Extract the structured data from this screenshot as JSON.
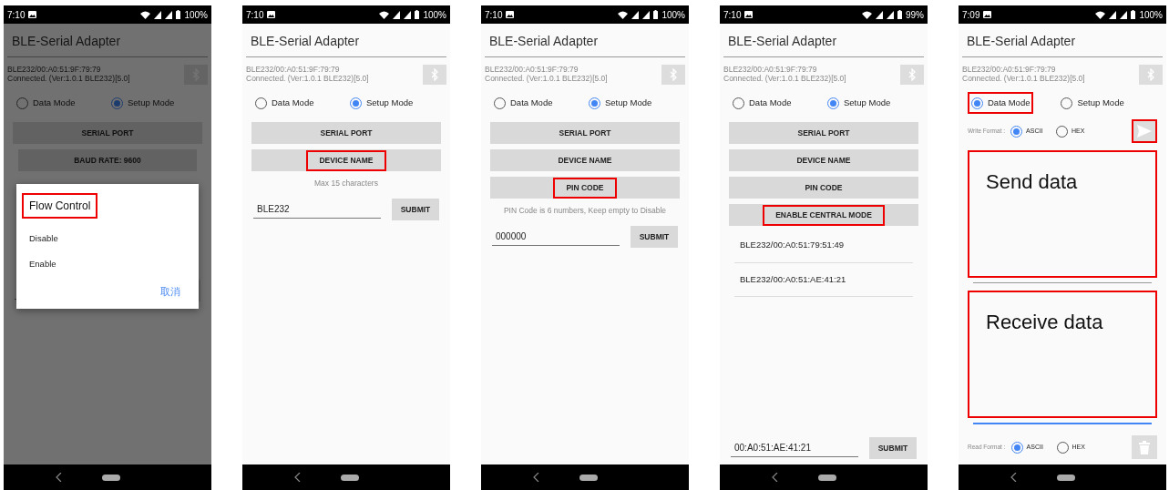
{
  "phones": [
    {
      "status": {
        "time": "7:10",
        "battery": "100%"
      },
      "title": "BLE-Serial Adapter",
      "device": [
        "BLE232/00:A0:51:9F:79:79",
        "Connected. (Ver:1.0.1 BLE232)[5.0]"
      ],
      "dimmed": true,
      "modes": [
        {
          "label": "Data Mode",
          "selected": false,
          "highlighted": false
        },
        {
          "label": "Setup Mode",
          "selected": true,
          "highlighted": false
        }
      ],
      "items": [
        {
          "kind": "button",
          "label": "SERIAL PORT",
          "highlighted": false
        },
        {
          "kind": "sub_button",
          "label": "BAUD RATE: 9600",
          "highlighted": false
        },
        {
          "kind": "covered"
        },
        {
          "kind": "field"
        }
      ],
      "dialog": {
        "title": "Flow Control",
        "highlighted": true,
        "options": [
          "Disable",
          "Enable"
        ],
        "cancel": "取消"
      }
    },
    {
      "status": {
        "time": "7:10",
        "battery": "100%"
      },
      "title": "BLE-Serial Adapter",
      "device": [
        "BLE232/00:A0:51:9F:79:79",
        "Connected. (Ver:1.0.1 BLE232)[5.0]"
      ],
      "dimmed": false,
      "modes": [
        {
          "label": "Data Mode",
          "selected": false,
          "highlighted": false
        },
        {
          "label": "Setup Mode",
          "selected": true,
          "highlighted": false
        }
      ],
      "items": [
        {
          "kind": "button",
          "label": "SERIAL PORT",
          "highlighted": false
        },
        {
          "kind": "button",
          "label": "DEVICE NAME",
          "highlighted": true
        },
        {
          "kind": "hint",
          "text": "Max 15 characters"
        },
        {
          "kind": "field",
          "value": "BLE232",
          "submit": "SUBMIT"
        }
      ]
    },
    {
      "status": {
        "time": "7:10",
        "battery": "100%"
      },
      "title": "BLE-Serial Adapter",
      "device": [
        "BLE232/00:A0:51:9F:79:79",
        "Connected. (Ver:1.0.1 BLE232)[5.0]"
      ],
      "dimmed": false,
      "modes": [
        {
          "label": "Data Mode",
          "selected": false,
          "highlighted": false
        },
        {
          "label": "Setup Mode",
          "selected": true,
          "highlighted": false
        }
      ],
      "items": [
        {
          "kind": "button",
          "label": "SERIAL PORT",
          "highlighted": false
        },
        {
          "kind": "button",
          "label": "DEVICE NAME",
          "highlighted": false
        },
        {
          "kind": "button",
          "label": "PIN CODE",
          "highlighted": true
        },
        {
          "kind": "hint",
          "text": "PIN Code is 6 numbers, Keep empty to Disable"
        },
        {
          "kind": "field",
          "value": "000000",
          "submit": "SUBMIT"
        }
      ]
    },
    {
      "status": {
        "time": "7:10",
        "battery": "99%"
      },
      "title": "BLE-Serial Adapter",
      "device": [
        "BLE232/00:A0:51:9F:79:79",
        "Connected. (Ver:1.0.1 BLE232)[5.0]"
      ],
      "dimmed": false,
      "modes": [
        {
          "label": "Data Mode",
          "selected": false,
          "highlighted": false
        },
        {
          "label": "Setup Mode",
          "selected": true,
          "highlighted": false
        }
      ],
      "items": [
        {
          "kind": "button",
          "label": "SERIAL PORT",
          "highlighted": false
        },
        {
          "kind": "button",
          "label": "DEVICE NAME",
          "highlighted": false
        },
        {
          "kind": "button",
          "label": "PIN CODE",
          "highlighted": false
        },
        {
          "kind": "button",
          "label": "ENABLE CENTRAL MODE",
          "highlighted": true
        },
        {
          "kind": "device",
          "text": "BLE232/00:A0:51:79:51:49"
        },
        {
          "kind": "device",
          "text": "BLE232/00:A0:51:AE:41:21"
        },
        {
          "kind": "spacer"
        },
        {
          "kind": "field",
          "value": "00:A0:51:AE:41:21",
          "submit": "SUBMIT"
        }
      ]
    },
    {
      "status": {
        "time": "7:09",
        "battery": "100%"
      },
      "title": "BLE-Serial Adapter",
      "device": [
        "BLE232/00:A0:51:9F:79:79",
        "Connected. (Ver:1.0.1 BLE232)[5.0]"
      ],
      "dimmed": false,
      "modes": [
        {
          "label": "Data Mode",
          "selected": true,
          "highlighted": true
        },
        {
          "label": "Setup Mode",
          "selected": false,
          "highlighted": false
        }
      ],
      "items": [
        {
          "kind": "write_format",
          "label": "Write Format :",
          "options": [
            {
              "label": "ASCII",
              "selected": true
            },
            {
              "label": "HEX",
              "selected": false
            }
          ],
          "highlighted": true
        },
        {
          "kind": "panel",
          "text": "Send data",
          "highlighted": true,
          "focused": false
        },
        {
          "kind": "panel",
          "text": "Receive data",
          "highlighted": true,
          "focused": true
        },
        {
          "kind": "read_format",
          "label": "Read Format :",
          "options": [
            {
              "label": "ASCII",
              "selected": true
            },
            {
              "label": "HEX",
              "selected": false
            }
          ],
          "highlighted": false
        }
      ]
    }
  ]
}
